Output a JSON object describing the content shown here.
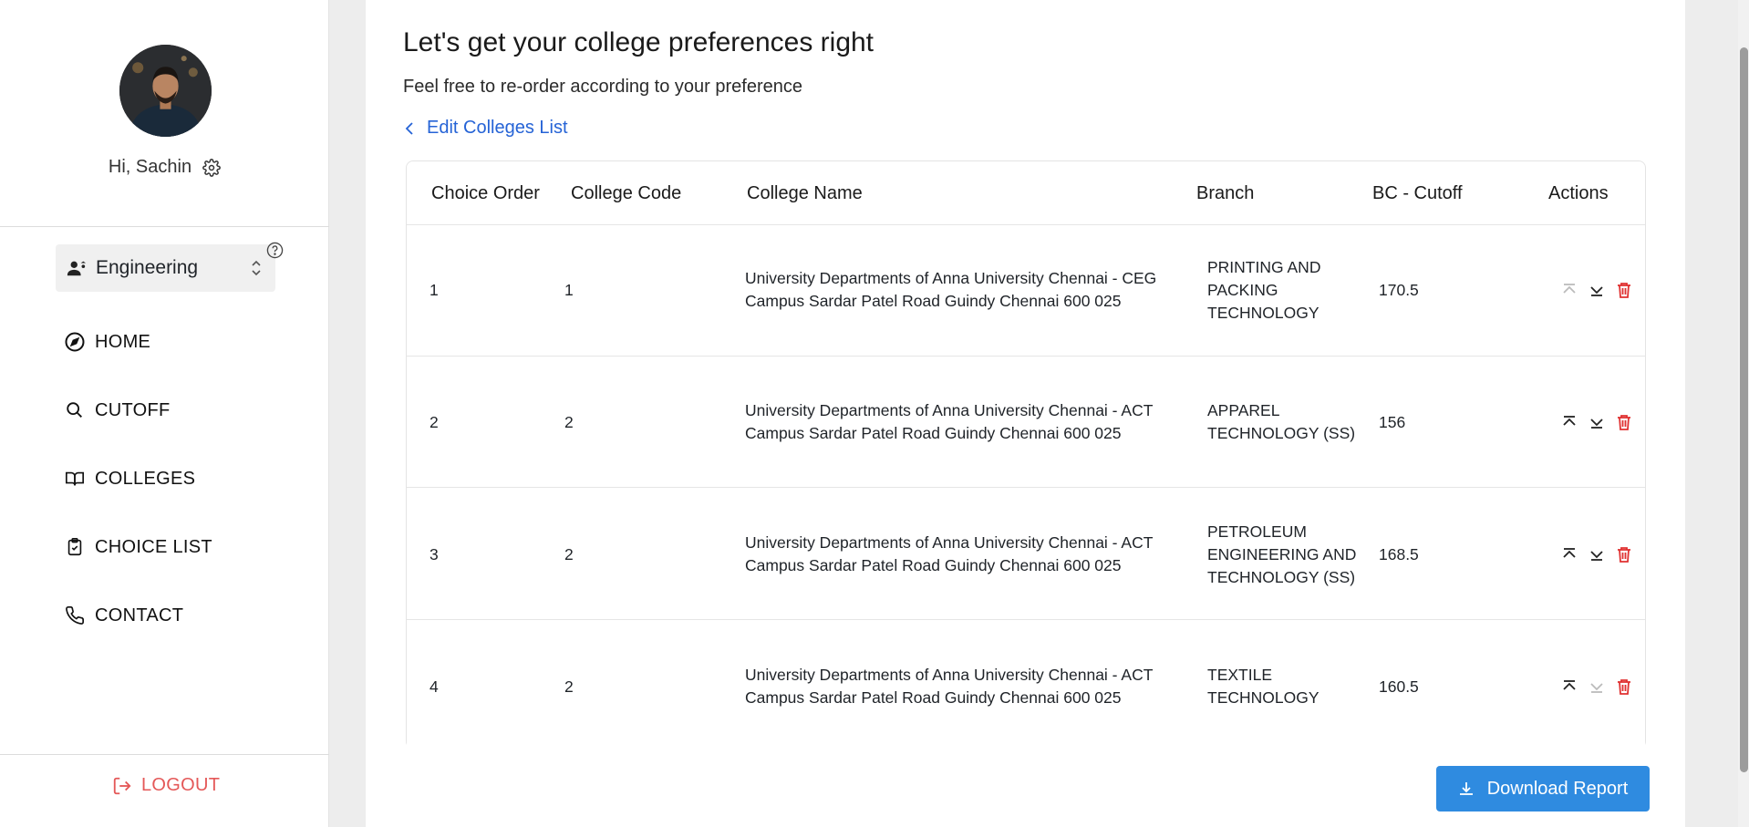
{
  "user": {
    "greeting": "Hi, Sachin"
  },
  "stream_select": {
    "value": "Engineering"
  },
  "nav": {
    "items": [
      {
        "label": "HOME",
        "icon": "compass-icon"
      },
      {
        "label": "CUTOFF",
        "icon": "search-icon"
      },
      {
        "label": "COLLEGES",
        "icon": "book-open-icon"
      },
      {
        "label": "CHOICE LIST",
        "icon": "clipboard-icon"
      },
      {
        "label": "CONTACT",
        "icon": "phone-icon"
      }
    ],
    "logout_label": "LOGOUT"
  },
  "main": {
    "title": "Let's get your college preferences right",
    "subtitle": "Feel free to re-order according to your preference",
    "edit_link": "Edit Colleges List",
    "download_label": "Download Report"
  },
  "table": {
    "headers": {
      "order": "Choice Order",
      "code": "College Code",
      "name": "College Name",
      "branch": "Branch",
      "cutoff": "BC - Cutoff",
      "actions": "Actions"
    },
    "rows": [
      {
        "order": "1",
        "code": "1",
        "name_l1": "University Departments of Anna University Chennai - CEG",
        "name_l2": "Campus Sardar Patel Road Guindy Chennai 600 025",
        "branch_l1": "PRINTING AND",
        "branch_l2": "PACKING",
        "branch_l3": "TECHNOLOGY",
        "cutoff": "170.5",
        "move_up_enabled": false,
        "move_down_enabled": true
      },
      {
        "order": "2",
        "code": "2",
        "name_l1": "University Departments of Anna University Chennai - ACT",
        "name_l2": "Campus Sardar Patel Road Guindy Chennai 600 025",
        "branch_l1": "APPAREL",
        "branch_l2": "TECHNOLOGY (SS)",
        "branch_l3": "",
        "cutoff": "156",
        "move_up_enabled": true,
        "move_down_enabled": true
      },
      {
        "order": "3",
        "code": "2",
        "name_l1": "University Departments of Anna University Chennai - ACT",
        "name_l2": "Campus Sardar Patel Road Guindy Chennai 600 025",
        "branch_l1": "PETROLEUM",
        "branch_l2": "ENGINEERING AND",
        "branch_l3": "TECHNOLOGY (SS)",
        "cutoff": "168.5",
        "move_up_enabled": true,
        "move_down_enabled": true
      },
      {
        "order": "4",
        "code": "2",
        "name_l1": "University Departments of Anna University Chennai - ACT",
        "name_l2": "Campus Sardar Patel Road Guindy Chennai 600 025",
        "branch_l1": "TEXTILE",
        "branch_l2": "TECHNOLOGY",
        "branch_l3": "",
        "cutoff": "160.5",
        "move_up_enabled": true,
        "move_down_enabled": false
      }
    ]
  },
  "colors": {
    "link": "#2563d6",
    "primary_button": "#2f8be0",
    "danger": "#e03131",
    "logout": "#e45858"
  }
}
